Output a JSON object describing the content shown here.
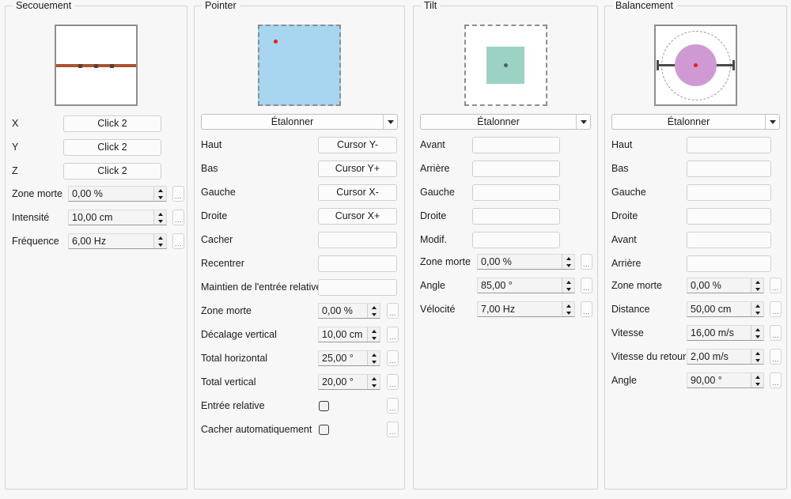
{
  "panels": {
    "secouement": {
      "title": "Secouement",
      "preview": {
        "type": "line-with-dots",
        "line_color": "#a8552e",
        "dot_color": "#5a4036",
        "background": "#ffffff",
        "border_color": "#8e8e8e",
        "dots": 3
      },
      "buttons": [
        {
          "label": "X",
          "value": "Click 2"
        },
        {
          "label": "Y",
          "value": "Click 2"
        },
        {
          "label": "Z",
          "value": "Click 2"
        }
      ],
      "spins": [
        {
          "label": "Zone morte",
          "value": "0,00 %"
        },
        {
          "label": "Intensité",
          "value": "10,00 cm"
        },
        {
          "label": "Fréquence",
          "value": "6,00 Hz"
        }
      ]
    },
    "pointer": {
      "title": "Pointer",
      "preview": {
        "type": "filled-square-dot",
        "fill": "#a8d5ef",
        "border_color": "#8e8e8e",
        "border_style": "dashed",
        "dot_color": "#ea1c1c"
      },
      "combo": {
        "value": "Étalonner"
      },
      "buttons": [
        {
          "label": "Haut",
          "value": "Cursor Y-"
        },
        {
          "label": "Bas",
          "value": "Cursor Y+"
        },
        {
          "label": "Gauche",
          "value": "Cursor X-"
        },
        {
          "label": "Droite",
          "value": "Cursor X+"
        },
        {
          "label": "Cacher",
          "value": ""
        },
        {
          "label": "Recentrer",
          "value": ""
        },
        {
          "label": "Maintien de l'entrée relative",
          "value": ""
        }
      ],
      "spins": [
        {
          "label": "Zone morte",
          "value": "0,00 %"
        },
        {
          "label": "Décalage vertical",
          "value": "10,00 cm"
        },
        {
          "label": "Total horizontal",
          "value": "25,00 °"
        },
        {
          "label": "Total vertical",
          "value": "20,00 °"
        }
      ],
      "checks": [
        {
          "label": "Entrée relative",
          "checked": false
        },
        {
          "label": "Cacher automatiquement",
          "checked": false
        }
      ]
    },
    "tilt": {
      "title": "Tilt",
      "preview": {
        "type": "inner-square-dot",
        "fill": "#9bd2c4",
        "border_color": "#8e8e8e",
        "border_style": "dashed",
        "dot_color": "#4c6560"
      },
      "combo": {
        "value": "Étalonner"
      },
      "buttons": [
        {
          "label": "Avant",
          "value": ""
        },
        {
          "label": "Arrière",
          "value": ""
        },
        {
          "label": "Gauche",
          "value": ""
        },
        {
          "label": "Droite",
          "value": ""
        },
        {
          "label": "Modif.",
          "value": ""
        }
      ],
      "spins": [
        {
          "label": "Zone morte",
          "value": "0,00 %"
        },
        {
          "label": "Angle",
          "value": "85,00 °"
        },
        {
          "label": "Vélocité",
          "value": "7,00 Hz"
        }
      ]
    },
    "balancement": {
      "title": "Balancement",
      "preview": {
        "type": "circle-ring-bar",
        "fill": "#cf9ad4",
        "border_color": "#8e8e8e",
        "border_style": "solid",
        "ring_color": "#9a9a9a",
        "bar_color": "#4a4a4a",
        "dot_color": "#ea1c1c"
      },
      "combo": {
        "value": "Étalonner"
      },
      "buttons": [
        {
          "label": "Haut",
          "value": ""
        },
        {
          "label": "Bas",
          "value": ""
        },
        {
          "label": "Gauche",
          "value": ""
        },
        {
          "label": "Droite",
          "value": ""
        },
        {
          "label": "Avant",
          "value": ""
        },
        {
          "label": "Arrière",
          "value": ""
        }
      ],
      "spins": [
        {
          "label": "Zone morte",
          "value": "0,00 %"
        },
        {
          "label": "Distance",
          "value": "50,00 cm"
        },
        {
          "label": "Vitesse",
          "value": "16,00 m/s"
        },
        {
          "label": "Vitesse du retour",
          "value": "2,00 m/s"
        },
        {
          "label": "Angle",
          "value": "90,00 °"
        }
      ]
    }
  },
  "icons": {
    "ellipsis": "...",
    "chevron_down": "▼",
    "spin_up": "▲",
    "spin_down": "▼"
  }
}
